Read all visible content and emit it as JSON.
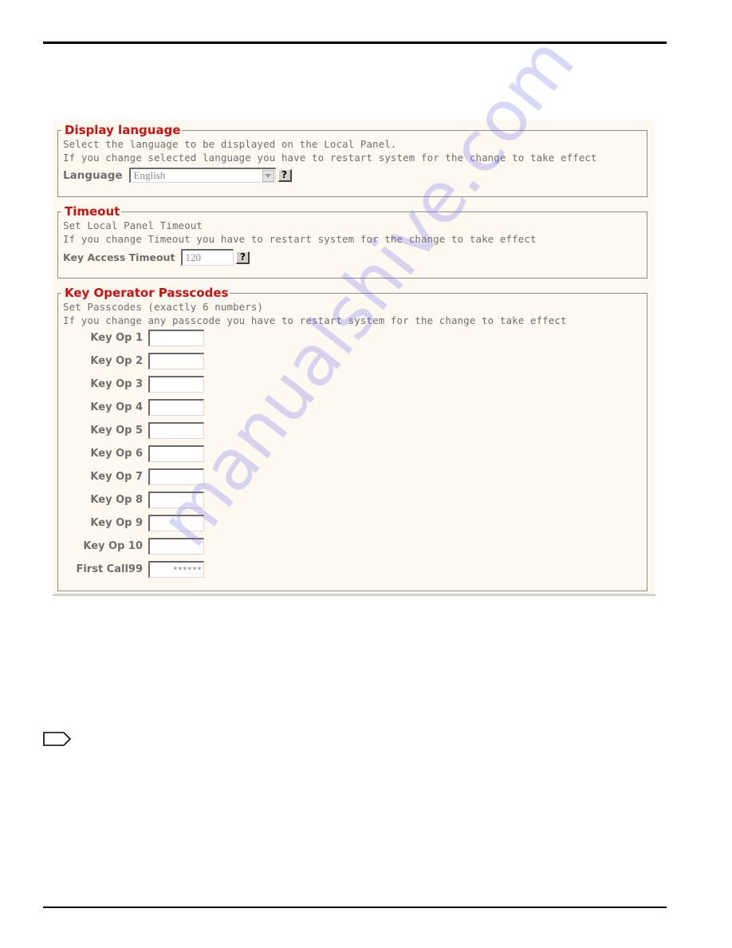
{
  "panel": {
    "display_language": {
      "title": "Display language",
      "desc_line1": "Select the language to be displayed on the Local Panel.",
      "desc_line2": "If you change selected language you have to restart system for the change to take effect",
      "field_label": "Language",
      "selected_value": "English",
      "help_label": "?"
    },
    "timeout": {
      "title": "Timeout",
      "desc_line1": "Set Local Panel Timeout",
      "desc_line2": "If you change Timeout you have to restart system for the change to take effect",
      "field_label": "Key Access Timeout",
      "value": "120",
      "help_label": "?"
    },
    "passcodes": {
      "title": "Key Operator Passcodes",
      "desc_line1": "Set Passcodes (exactly 6 numbers)",
      "desc_line2": "If you change any passcode you have to restart system for the change to take effect",
      "fields": [
        {
          "label": "Key Op 1",
          "value": ""
        },
        {
          "label": "Key Op 2",
          "value": ""
        },
        {
          "label": "Key Op 3",
          "value": ""
        },
        {
          "label": "Key Op 4",
          "value": ""
        },
        {
          "label": "Key Op 5",
          "value": ""
        },
        {
          "label": "Key Op 6",
          "value": ""
        },
        {
          "label": "Key Op 7",
          "value": ""
        },
        {
          "label": "Key Op 8",
          "value": ""
        },
        {
          "label": "Key Op 9",
          "value": ""
        },
        {
          "label": "Key Op 10",
          "value": ""
        },
        {
          "label": "First Call99",
          "value": "******"
        }
      ]
    }
  },
  "watermark": "manualshive.com"
}
